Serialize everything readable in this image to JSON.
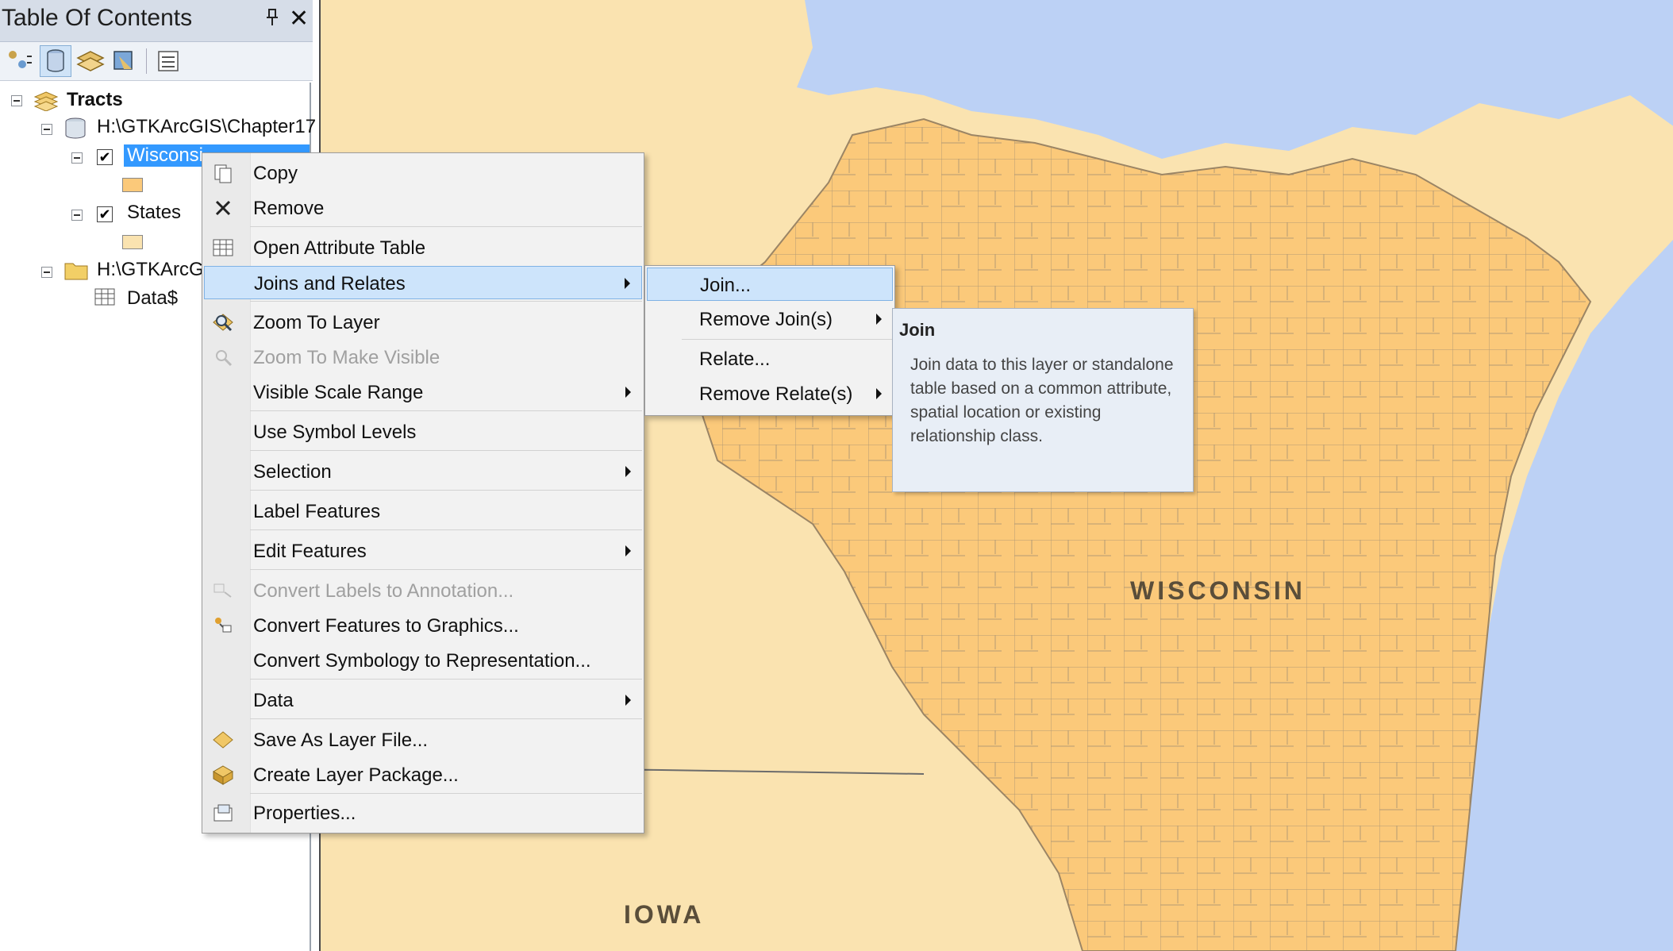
{
  "toc": {
    "title": "Table Of Contents",
    "pin_icon": "pin-icon",
    "close_label": "✕",
    "toolbar": [
      {
        "icon": "list-by-drawing-order-icon"
      },
      {
        "icon": "list-by-source-icon"
      },
      {
        "icon": "list-by-visibility-icon"
      },
      {
        "icon": "list-by-selection-icon"
      },
      {
        "icon": "options-icon"
      }
    ],
    "tree": {
      "dataframe": "Tracts",
      "source1": "H:\\GTKArcGIS\\Chapter17",
      "layer1": "Wisconsin County Tracts",
      "layer1_visible_label": "Wisconsi",
      "layer2": "States",
      "source2": "H:\\GTKArcG",
      "table": "Data$",
      "checkmark": "✔"
    }
  },
  "map": {
    "labels": {
      "wisconsin": "WISCONSIN",
      "iowa": "IOWA"
    },
    "colors": {
      "land": "#fae3b0",
      "water": "#bcd1f5",
      "tracts": "#fbc97a"
    }
  },
  "context_menu": {
    "items": [
      {
        "label": "Copy",
        "icon": "copy-icon",
        "enabled": true,
        "submenu": false
      },
      {
        "label": "Remove",
        "icon": "remove-icon",
        "enabled": true,
        "submenu": false
      },
      {
        "label": "Open Attribute Table",
        "icon": "table-icon",
        "enabled": true,
        "submenu": false
      },
      {
        "label": "Joins and Relates",
        "icon": "",
        "enabled": true,
        "submenu": true,
        "highlighted": true
      },
      {
        "label": "Zoom To Layer",
        "icon": "zoom-to-layer-icon",
        "enabled": true,
        "submenu": false
      },
      {
        "label": "Zoom To Make Visible",
        "icon": "zoom-to-visible-icon",
        "enabled": false,
        "submenu": false
      },
      {
        "label": "Visible Scale Range",
        "icon": "",
        "enabled": true,
        "submenu": true
      },
      {
        "label": "Use Symbol Levels",
        "icon": "",
        "enabled": true,
        "submenu": false
      },
      {
        "label": "Selection",
        "icon": "",
        "enabled": true,
        "submenu": true
      },
      {
        "label": "Label Features",
        "icon": "",
        "enabled": true,
        "submenu": false
      },
      {
        "label": "Edit Features",
        "icon": "",
        "enabled": true,
        "submenu": true
      },
      {
        "label": "Convert Labels to Annotation...",
        "icon": "convert-labels-icon",
        "enabled": false,
        "submenu": false
      },
      {
        "label": "Convert Features to Graphics...",
        "icon": "convert-graphics-icon",
        "enabled": true,
        "submenu": false
      },
      {
        "label": "Convert Symbology to Representation...",
        "icon": "",
        "enabled": true,
        "submenu": false
      },
      {
        "label": "Data",
        "icon": "",
        "enabled": true,
        "submenu": true
      },
      {
        "label": "Save As Layer File...",
        "icon": "layer-file-icon",
        "enabled": true,
        "submenu": false
      },
      {
        "label": "Create Layer Package...",
        "icon": "layer-package-icon",
        "enabled": true,
        "submenu": false
      },
      {
        "label": "Properties...",
        "icon": "properties-icon",
        "enabled": true,
        "submenu": false
      }
    ]
  },
  "submenu": {
    "items": [
      {
        "label": "Join...",
        "submenu": false,
        "highlighted": true
      },
      {
        "label": "Remove Join(s)",
        "submenu": true
      },
      {
        "label": "Relate...",
        "submenu": false
      },
      {
        "label": "Remove Relate(s)",
        "submenu": true
      }
    ]
  },
  "tooltip": {
    "title": "Join",
    "body": "Join data to this layer or standalone table based on a common attribute, spatial location or existing relationship class."
  }
}
